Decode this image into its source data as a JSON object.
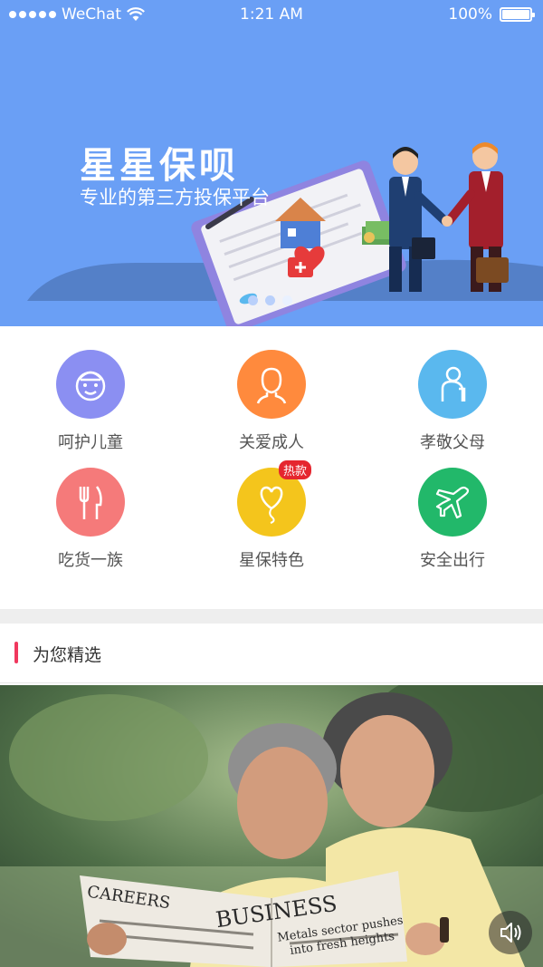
{
  "status_bar": {
    "carrier": "WeChat",
    "time": "1:21 AM",
    "battery": "100%"
  },
  "banner": {
    "title": "星星保呗",
    "subtitle": "专业的第三方投保平台",
    "pages": 3,
    "active_page": 3
  },
  "categories": [
    {
      "label": "呵护儿童",
      "icon": "child-face-icon",
      "color": "#8b8ff2"
    },
    {
      "label": "关爱成人",
      "icon": "adult-face-icon",
      "color": "#ff8a3d"
    },
    {
      "label": "孝敬父母",
      "icon": "elder-with-cane-icon",
      "color": "#5ab8ee"
    },
    {
      "label": "吃货一族",
      "icon": "fork-knife-icon",
      "color": "#f57a7a"
    },
    {
      "label": "星保特色",
      "icon": "heart-balloon-icon",
      "color": "#f4c51c",
      "badge": "热款"
    },
    {
      "label": "安全出行",
      "icon": "airplane-icon",
      "color": "#22b86a"
    }
  ],
  "featured": {
    "title": "为您精选"
  },
  "photo": {
    "newspaper_text_1": "CAREERS",
    "newspaper_text_2": "BUSINESS",
    "newspaper_text_3": "Metals sector pushes",
    "newspaper_text_4": "into fresh heights",
    "sound_icon": "speaker-icon"
  },
  "colors": {
    "brand_blue": "#6a9ff5",
    "accent_red": "#f0385e",
    "badge_red": "#e5262f"
  }
}
